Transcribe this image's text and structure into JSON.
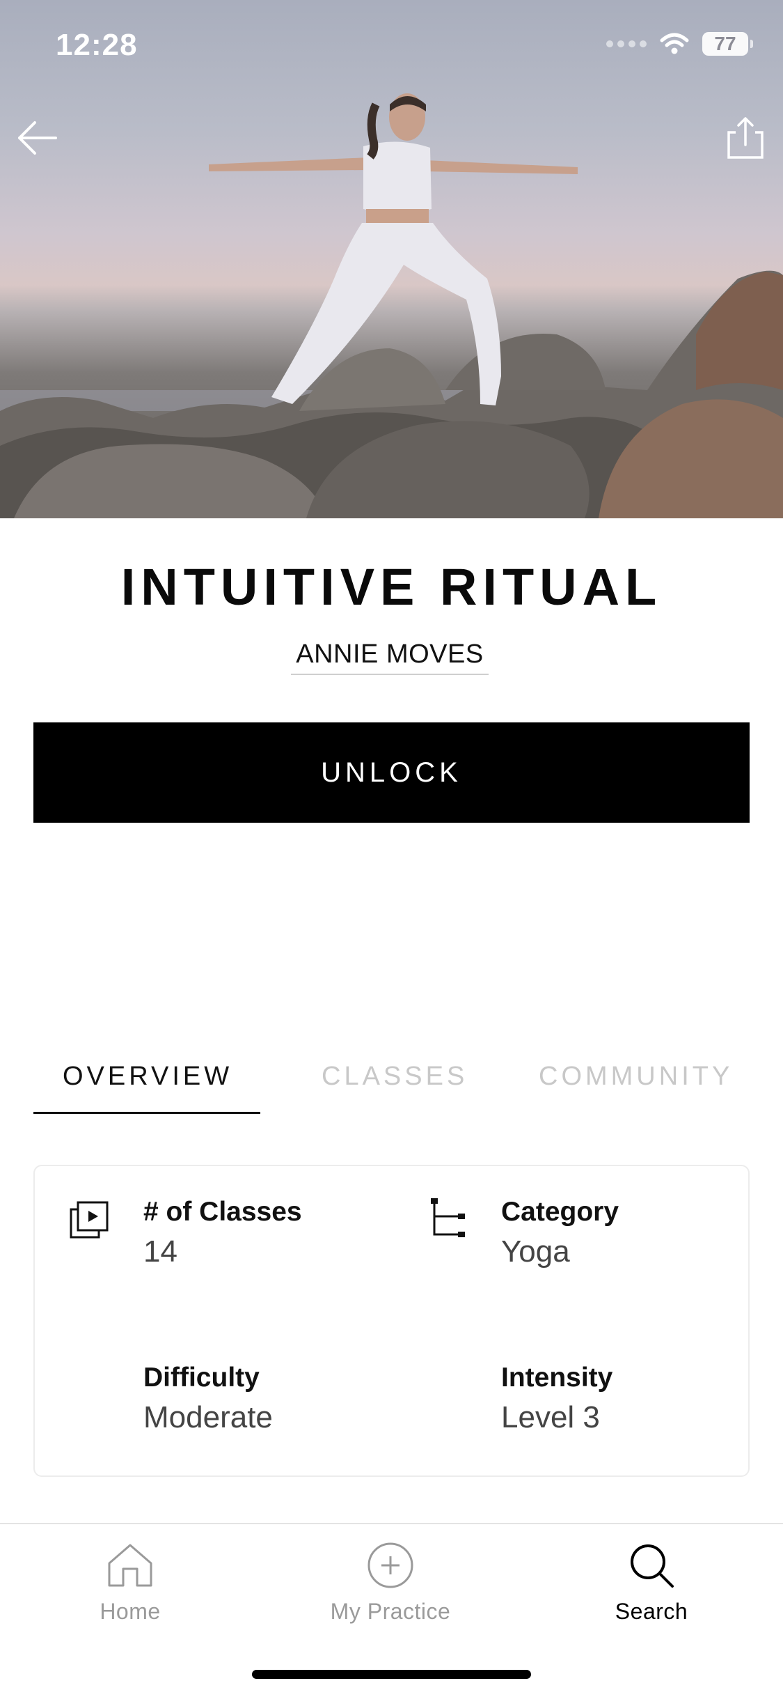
{
  "status_bar": {
    "time": "12:28",
    "battery": "77"
  },
  "header": {
    "back_icon": "arrow-left-icon",
    "share_icon": "share-icon"
  },
  "program": {
    "title": "INTUITIVE RITUAL",
    "author": "ANNIE MOVES",
    "unlock_label": "UNLOCK"
  },
  "tabs": [
    {
      "label": "OVERVIEW",
      "active": true
    },
    {
      "label": "CLASSES",
      "active": false
    },
    {
      "label": "COMMUNITY",
      "active": false
    }
  ],
  "details": {
    "classes": {
      "label": "# of Classes",
      "value": "14",
      "icon": "video-stack-icon"
    },
    "category": {
      "label": "Category",
      "value": "Yoga",
      "icon": "category-tree-icon"
    },
    "difficulty": {
      "label": "Difficulty",
      "value": "Moderate"
    },
    "intensity": {
      "label": "Intensity",
      "value": "Level 3"
    }
  },
  "bottom_nav": [
    {
      "label": "Home",
      "icon": "home-icon",
      "active": false
    },
    {
      "label": "My Practice",
      "icon": "plus-circle-icon",
      "active": false
    },
    {
      "label": "Search",
      "icon": "search-icon",
      "active": true
    }
  ],
  "colors": {
    "primary": "#000000",
    "inactive_tab": "#c8c8c8",
    "inactive_nav": "#9a9a9a"
  }
}
